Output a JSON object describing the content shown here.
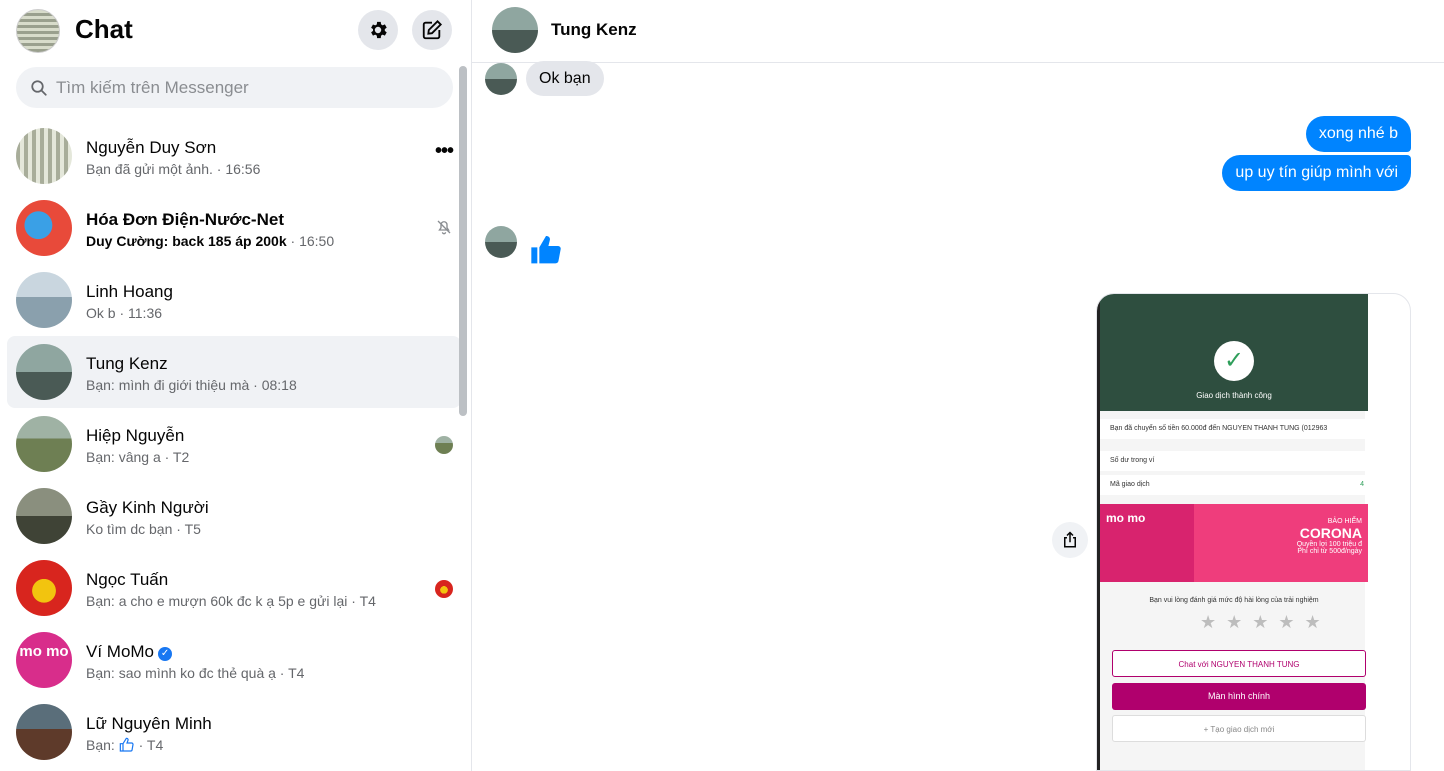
{
  "sidebar": {
    "title": "Chat",
    "search_placeholder": "Tìm kiếm trên Messenger",
    "conversations": [
      {
        "name": "Nguyễn Duy Sơn",
        "preview": "Bạn đã gửi một ảnh.",
        "time": "· 16:56",
        "unread": false
      },
      {
        "name": "Hóa Đơn Điện-Nước-Net",
        "preview": "Duy Cường: back 185 áp 200k",
        "time": "· 16:50",
        "unread": true,
        "muted": true
      },
      {
        "name": "Linh Hoang",
        "preview": "Ok b",
        "time": "· 11:36",
        "unread": false
      },
      {
        "name": "Tung Kenz",
        "preview": "Bạn: mình đi giới thiệu mà",
        "time": "· 08:18",
        "unread": false,
        "active": true
      },
      {
        "name": "Hiệp Nguyễn",
        "preview": "Bạn: vâng a",
        "time": "· T2",
        "unread": false
      },
      {
        "name": "Gầy Kinh Người",
        "preview": "Ko tìm dc bạn",
        "time": "· T5",
        "unread": false
      },
      {
        "name": "Ngọc Tuấn",
        "preview": "Bạn: a cho e mượn 60k đc k ạ 5p e gửi lại",
        "time": "· T4",
        "unread": false
      },
      {
        "name": "Ví MoMo",
        "preview": "Bạn: sao mình ko đc thẻ quà ạ",
        "time": "· T4",
        "unread": false,
        "verified": true,
        "avatar_text": "mo mo"
      },
      {
        "name": "Lữ Nguyên Minh",
        "preview": "Bạn:",
        "time": "· T4",
        "unread": false
      }
    ]
  },
  "chat": {
    "contact_name": "Tung Kenz",
    "messages": [
      {
        "from": "them",
        "text": "Ok bạn"
      },
      {
        "from": "me",
        "text": "xong nhé b"
      },
      {
        "from": "me",
        "text": "up uy tín giúp mình với"
      },
      {
        "from": "them",
        "type": "like"
      },
      {
        "from": "me",
        "type": "image"
      }
    ],
    "receipt": {
      "status": "Giao dịch thành công",
      "line1": "Bạn đã chuyển số tiền 60.000đ đến NGUYEN THANH TUNG (012963",
      "line2": "Số dư trong ví",
      "line3": "Mã giao dịch",
      "line3_value": "4",
      "banner_brand": "mo mo",
      "banner_title": "BẢO HIỂM",
      "banner_main": "CORONA",
      "banner_sub": "Quyền lợi 100 triệu đ",
      "banner_fee": "Phí chỉ từ 500đ/ngày",
      "rate_text": "Bạn vui lòng đánh giá mức độ hài lòng của trải nghiệm",
      "btn_chat": "Chat với NGUYEN THANH TUNG",
      "btn_home": "Màn hình chính",
      "btn_new": "+ Tạo giao dịch mới"
    }
  },
  "colors": {
    "accent": "#0084ff",
    "active_row": "#f0f2f5",
    "bubble_in": "#e4e6eb",
    "momo": "#b0006d"
  }
}
